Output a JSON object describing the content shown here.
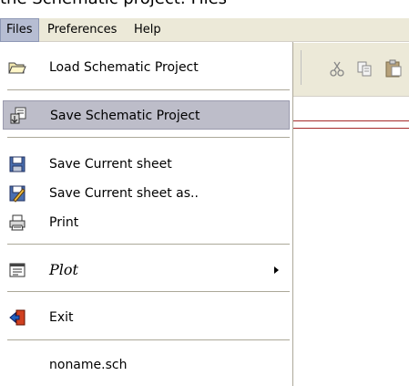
{
  "title_fragment": "the Schematic project: Files",
  "menubar": {
    "items": [
      {
        "label": "Files"
      },
      {
        "label": "Preferences"
      },
      {
        "label": "Help"
      }
    ]
  },
  "files_menu": {
    "items": [
      {
        "label": "Load Schematic Project",
        "icon": "open-folder-icon"
      },
      {
        "label": "Save Schematic Project",
        "icon": "save-project-icon",
        "highlighted": true
      },
      {
        "label": "Save Current sheet",
        "icon": "floppy-disk-icon"
      },
      {
        "label": "Save Current sheet as..",
        "icon": "floppy-disk-pencil-icon"
      },
      {
        "label": "Print",
        "icon": "printer-icon"
      },
      {
        "label": "Plot",
        "icon": "plot-icon",
        "submenu": true
      },
      {
        "label": "Exit",
        "icon": "exit-icon"
      },
      {
        "label": "noname.sch",
        "icon": ""
      }
    ]
  },
  "colors": {
    "menubar_bg": "#ece9d8",
    "highlight_bg": "#bdbdc9",
    "sheet_line": "#a52a2a"
  }
}
